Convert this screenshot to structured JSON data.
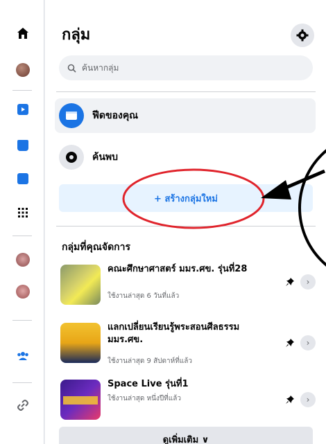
{
  "header": {
    "title": "กลุ่ม"
  },
  "search": {
    "placeholder": "ค้นหากลุ่ม"
  },
  "nav": [
    {
      "label": "ฟีดของคุณ",
      "icon": "feed-icon"
    },
    {
      "label": "ค้นพบ",
      "icon": "compass-icon"
    }
  ],
  "create": {
    "label": "+ สร้างกลุ่มใหม่"
  },
  "managed": {
    "title": "กลุ่มที่คุณจัดการ",
    "groups": [
      {
        "name": "คณะศึกษาศาสตร์ มมร.ศข. รุ่นที่28",
        "meta": "ใช้งานล่าสุด 6 วันที่แล้ว"
      },
      {
        "name": "แลกเปลี่ยนเรียนรู้พระสอนศีลธรรม มมร.ศข.",
        "meta": "ใช้งานล่าสุด 9 สัปดาห์ที่แล้ว"
      },
      {
        "name": "Space Live รุ่นที่1",
        "meta": "ใช้งานล่าสุด หนึ่งปีที่แล้ว"
      }
    ]
  },
  "see_more": {
    "label": "ดูเพิ่มเติม ∨"
  },
  "colors": {
    "accent": "#1b74e4",
    "accent_bg": "#e7f3ff",
    "annotation": "#e0242c"
  }
}
